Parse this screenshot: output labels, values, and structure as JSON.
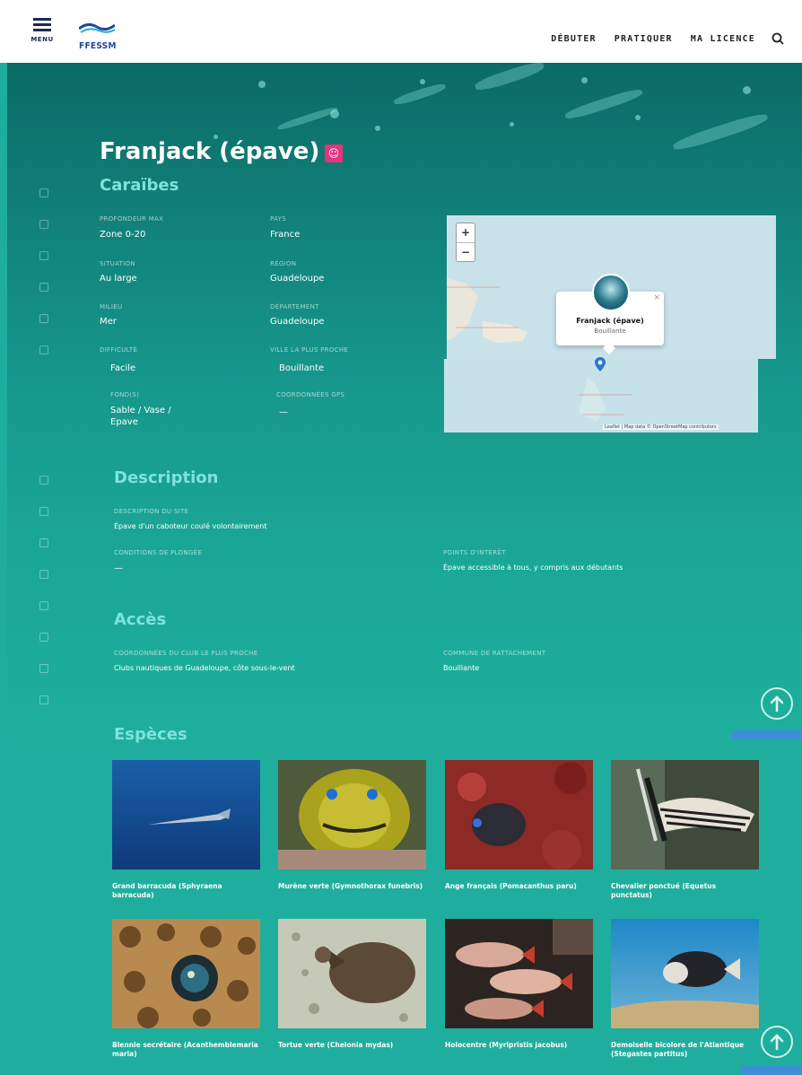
{
  "header": {
    "menu_label": "MENU",
    "logo_text": "FFESSM",
    "nav": [
      "DÉBUTER",
      "PRATIQUER",
      "MA LICENCE"
    ]
  },
  "site": {
    "title": "Franjack (épave)",
    "subtitle": "Caraïbes",
    "fields": [
      {
        "label": "PROFONDEUR MAX",
        "value": "Zone 0-20"
      },
      {
        "label": "PAYS",
        "value": "France"
      },
      {
        "label": "SITUATION",
        "value": "Au large"
      },
      {
        "label": "RÉGION",
        "value": "Guadeloupe"
      },
      {
        "label": "MILIEU",
        "value": "Mer"
      },
      {
        "label": "DÉPARTEMENT",
        "value": "Guadeloupe"
      },
      {
        "label": "DIFFICULTÉ",
        "value": "Facile"
      },
      {
        "label": "VILLE LA PLUS PROCHE",
        "value": "Bouillante"
      },
      {
        "label": "FOND(S)",
        "value": "Sable / Vase /\nEpave"
      },
      {
        "label": "COORDONNÉES GPS",
        "value": "—"
      }
    ]
  },
  "map": {
    "zoom_in": "+",
    "zoom_out": "−",
    "popup_title": "Franjack (épave)",
    "popup_subtitle": "Bouillante",
    "popup_close": "×",
    "attribution": "Leaflet | Map data © OpenStreetMap contributors"
  },
  "description": {
    "heading": "Description",
    "fields": [
      {
        "label": "DESCRIPTION DU SITE",
        "value": "Épave d'un caboteur coulé volontairement"
      },
      {
        "label": "CONDITIONS DE PLONGÉE",
        "value": "—"
      },
      {
        "label": "POINTS D'INTÉRÊT",
        "value": "Épave accessible à tous, y compris aux débutants"
      }
    ]
  },
  "acces": {
    "heading": "Accès",
    "fields": [
      {
        "label": "COORDONNÉES DU CLUB LE PLUS PROCHE",
        "value": "Clubs nautiques de Guadeloupe, côte sous-le-vent"
      },
      {
        "label": "COMMUNE DE RATTACHEMENT",
        "value": "Bouillante"
      }
    ]
  },
  "species": {
    "heading": "Espèces",
    "items": [
      {
        "name": "Grand barracuda (Sphyraena barracuda)"
      },
      {
        "name": "Murène verte (Gymnothorax funebris)"
      },
      {
        "name": "Ange français (Pomacanthus paru)"
      },
      {
        "name": "Chevalier ponctué (Equetus punctatus)"
      },
      {
        "name": "Blennie secrétaire (Acanthemblemaria maria)"
      },
      {
        "name": "Tortue verte (Chelonia mydas)"
      },
      {
        "name": "Holocentre (Myripristis jacobus)"
      },
      {
        "name": "Demoiselle bicolore de l'Atlantique (Stegastes partitus)"
      }
    ]
  },
  "colors": {
    "teal": "#1fae9d",
    "accent_heading": "#7fe3da",
    "badge_pink": "#e6337b",
    "logo_blue": "#1c4aa0"
  }
}
